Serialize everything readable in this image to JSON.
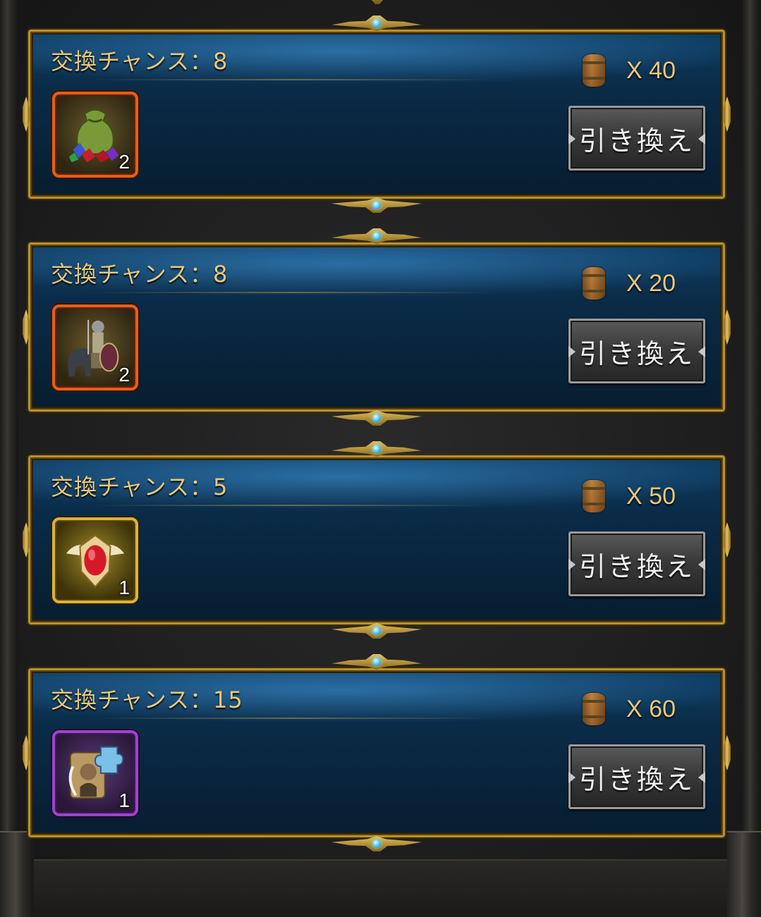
{
  "cards": [
    {
      "title": "交換チャンス：8",
      "cost": "X 40",
      "currency_icon": "barrel-icon",
      "item": {
        "icon": "gem-bag-icon",
        "rarity": "orange",
        "quantity": "2"
      },
      "button_label": "引き換え"
    },
    {
      "title": "交換チャンス：8",
      "cost": "X 20",
      "currency_icon": "barrel-icon",
      "item": {
        "icon": "cavalry-knight-icon",
        "rarity": "orange",
        "quantity": "2"
      },
      "button_label": "引き換え"
    },
    {
      "title": "交換チャンス：5",
      "cost": "X 50",
      "currency_icon": "barrel-icon",
      "item": {
        "icon": "winged-red-emblem-icon",
        "rarity": "gold",
        "quantity": "1"
      },
      "button_label": "引き換え"
    },
    {
      "title": "交換チャンス：15",
      "cost": "X 60",
      "currency_icon": "barrel-icon",
      "item": {
        "icon": "hero-puzzle-piece-icon",
        "rarity": "purple",
        "quantity": "1"
      },
      "button_label": "引き換え"
    }
  ],
  "colors": {
    "gold_text": "#e8c97a",
    "frame_gold": "#b8912e",
    "panel_blue": "#0b2f4e",
    "rarity_orange": "#e0601e",
    "rarity_gold": "#d9b43a",
    "rarity_purple": "#9a46c8"
  }
}
